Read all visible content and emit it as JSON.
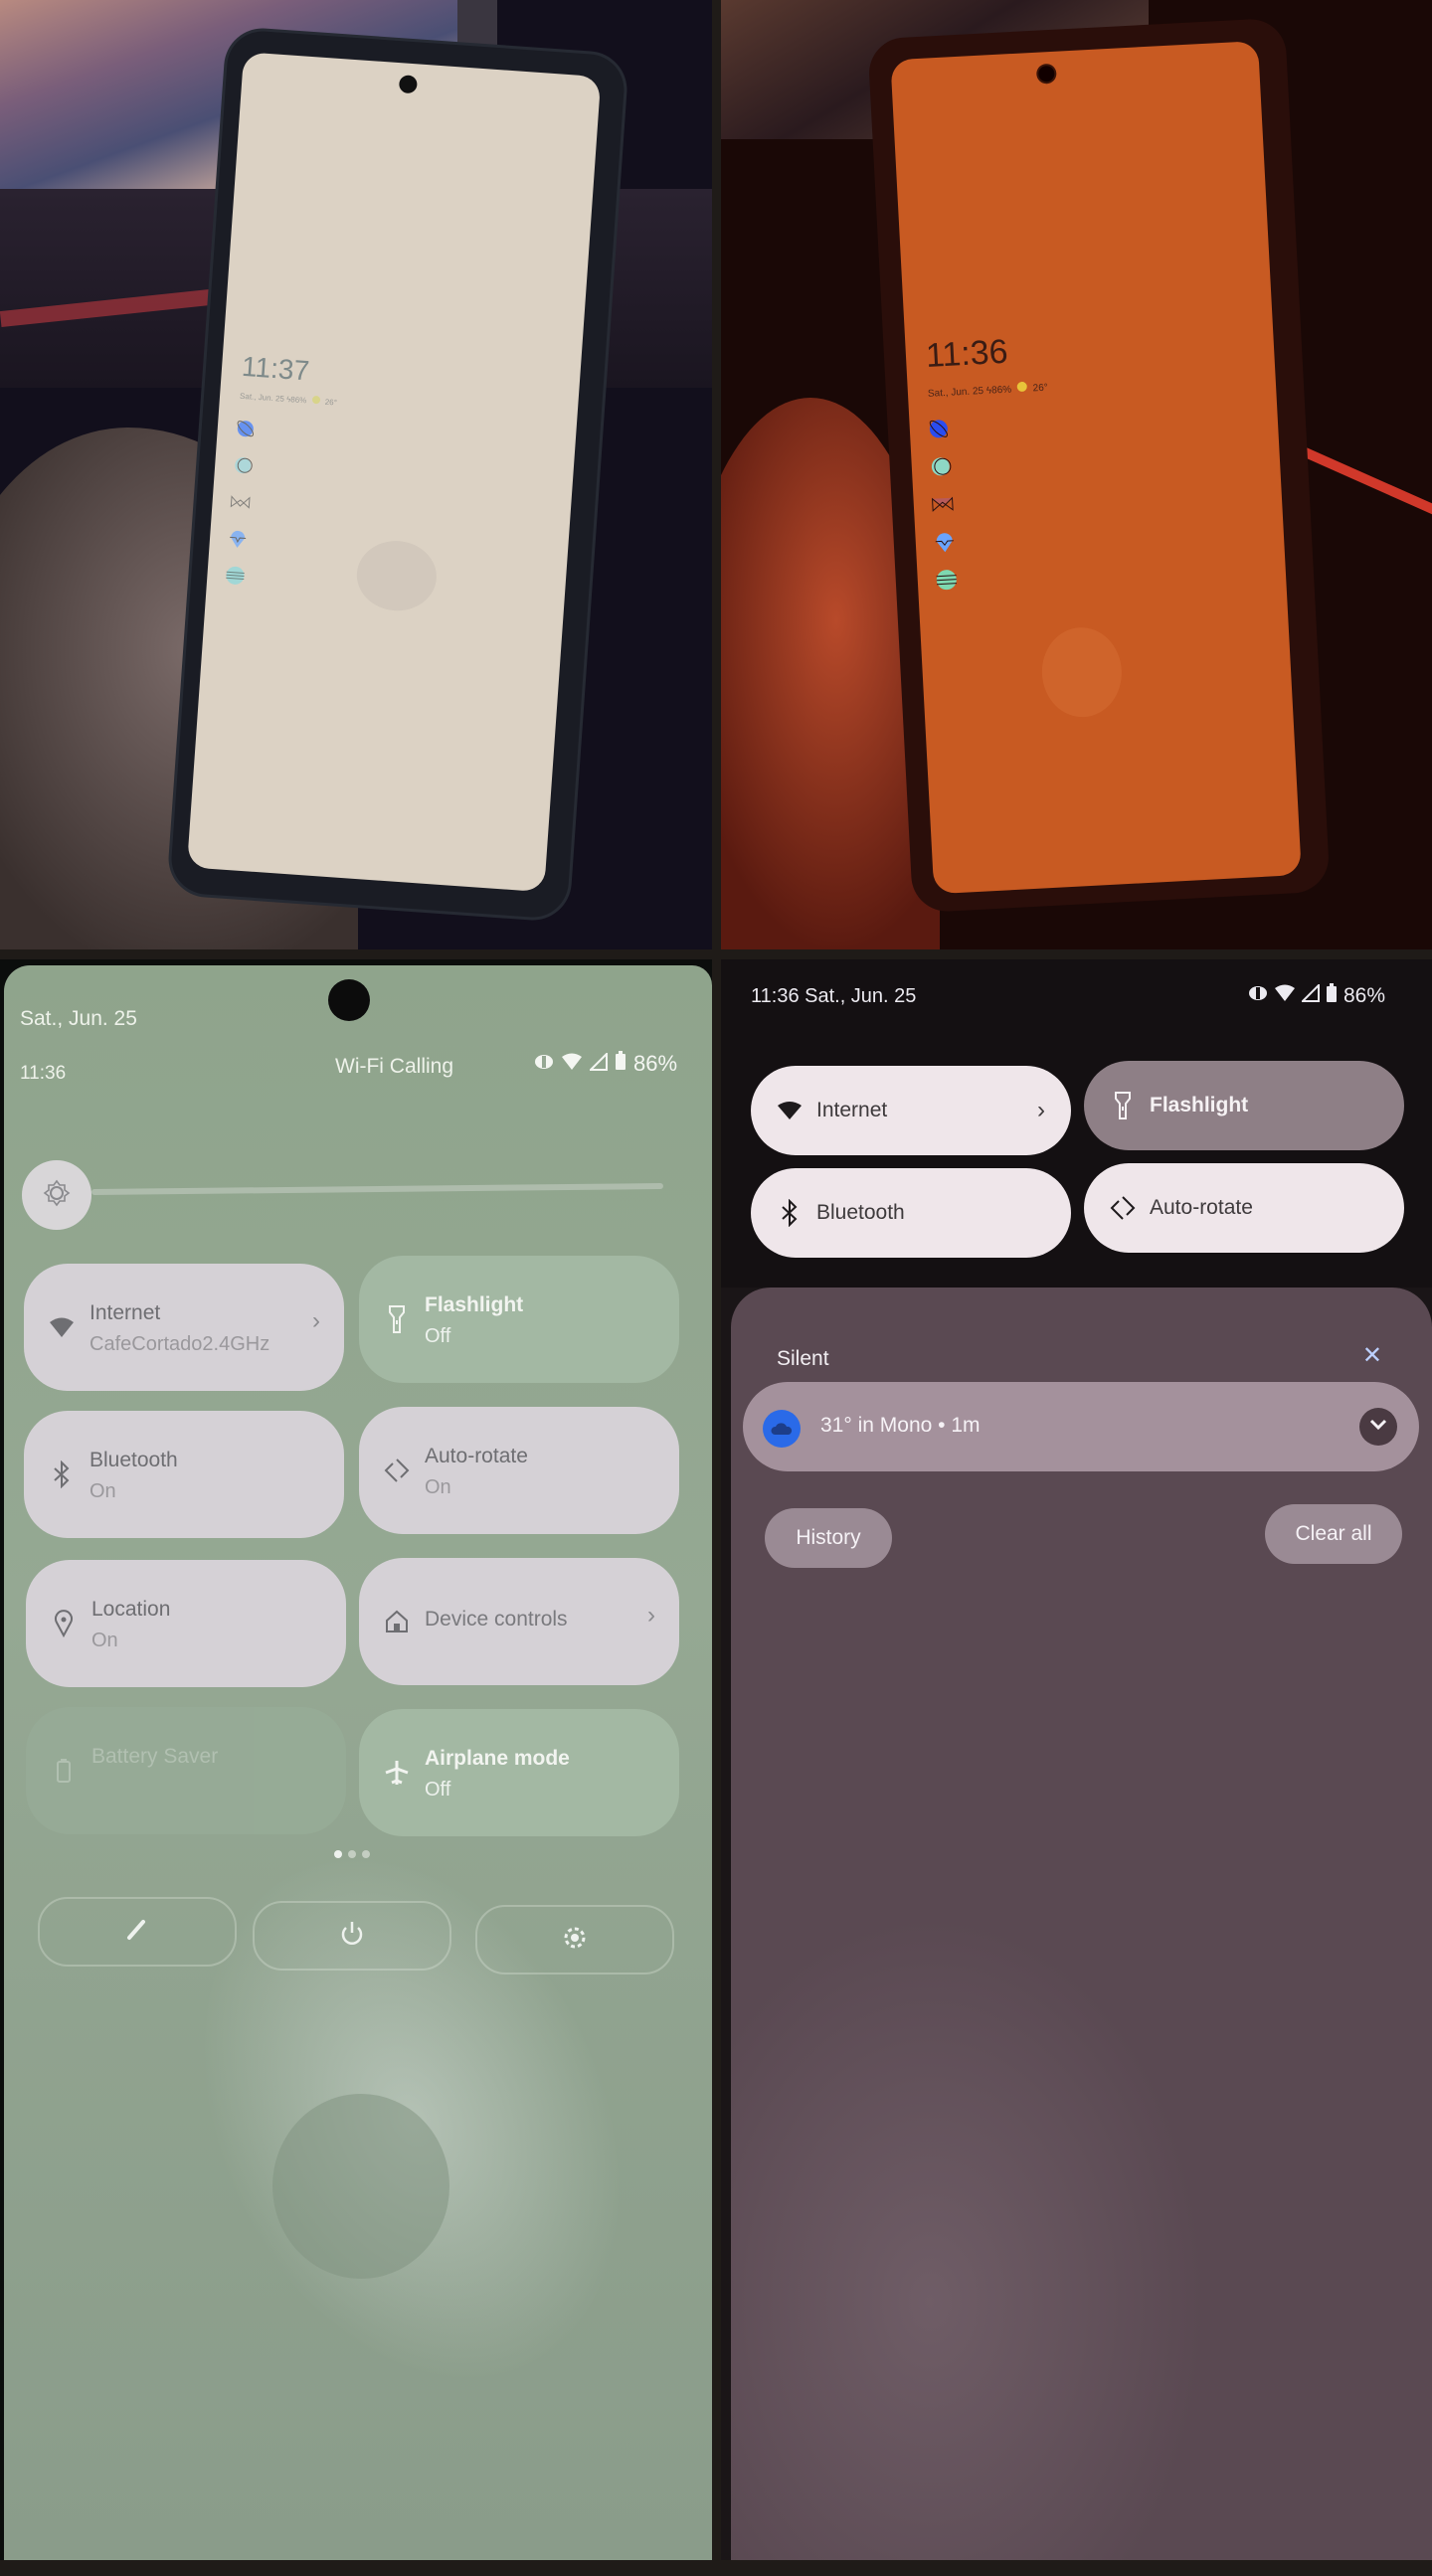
{
  "panels": {
    "top_left": {
      "description": "Phone always-on display (warm white tint)",
      "aod_time": "11:37",
      "aod_info": "Sat., Jun. 25 ϟ86%",
      "aod_weather": "26°",
      "aod_icons": [
        "planet-icon",
        "moon-icon",
        "bowtie-icon",
        "location-pin-icon",
        "striped-planet-icon"
      ]
    },
    "top_right": {
      "description": "Phone always-on display (orange tint)",
      "aod_time": "11:36",
      "aod_info": "Sat., Jun. 25 ϟ86%",
      "aod_weather": "26°",
      "aod_icons": [
        "planet-icon",
        "moon-icon",
        "bowtie-icon",
        "location-pin-icon",
        "striped-planet-icon"
      ]
    },
    "bottom_left": {
      "description": "Quick settings expanded (green tint)",
      "date": "Sat., Jun. 25",
      "time": "11:36",
      "carrier_text": "Wi-Fi Calling",
      "battery": "86%",
      "tiles": [
        {
          "title": "Internet",
          "subtitle": "CafeCortado2.4GHz",
          "icon": "wifi-icon",
          "state": "on",
          "has_chevron": true
        },
        {
          "title": "Flashlight",
          "subtitle": "Off",
          "icon": "flashlight-icon",
          "state": "off"
        },
        {
          "title": "Bluetooth",
          "subtitle": "On",
          "icon": "bluetooth-icon",
          "state": "on"
        },
        {
          "title": "Auto-rotate",
          "subtitle": "On",
          "icon": "auto-rotate-icon",
          "state": "on"
        },
        {
          "title": "Location",
          "subtitle": "On",
          "icon": "location-icon",
          "state": "on"
        },
        {
          "title": "Device controls",
          "subtitle": "",
          "icon": "home-icon",
          "state": "on",
          "has_chevron": true
        },
        {
          "title": "Battery Saver",
          "subtitle": "",
          "icon": "battery-icon",
          "state": "unavailable"
        },
        {
          "title": "Airplane mode",
          "subtitle": "Off",
          "icon": "airplane-icon",
          "state": "off"
        }
      ],
      "page_indicator": {
        "current": 1,
        "total": 3
      },
      "footer_buttons": [
        "edit-icon",
        "power-icon",
        "settings-icon"
      ]
    },
    "bottom_right": {
      "description": "Notification shade (dark theme)",
      "status_time_date": "11:36 Sat., Jun. 25",
      "battery": "86%",
      "tiles": [
        {
          "label": "Internet",
          "icon": "wifi-icon",
          "state": "on",
          "has_chevron": true
        },
        {
          "label": "Flashlight",
          "icon": "flashlight-icon",
          "state": "off"
        },
        {
          "label": "Bluetooth",
          "icon": "bluetooth-icon",
          "state": "on"
        },
        {
          "label": "Auto-rotate",
          "icon": "auto-rotate-icon",
          "state": "on"
        }
      ],
      "section_title": "Silent",
      "notification": {
        "text": "31° in Mono • 1m",
        "icon": "cloud-icon"
      },
      "history_label": "History",
      "clear_all_label": "Clear all"
    }
  },
  "colors": {
    "aod_warm_bg": "#dcd2c4",
    "aod_orange_bg": "#c85a22",
    "qs_green_bg": "#8fa48c",
    "qs_tile_on": "#d5d1d6",
    "qs_tile_off": "#a3b8a3",
    "shade_bg": "#5a4952",
    "shade_tile_on": "#efe6ea",
    "shade_tile_off": "#8e7f86",
    "notif_icon_blue": "#2a6ae8",
    "close_icon": "#bcd0ff"
  }
}
